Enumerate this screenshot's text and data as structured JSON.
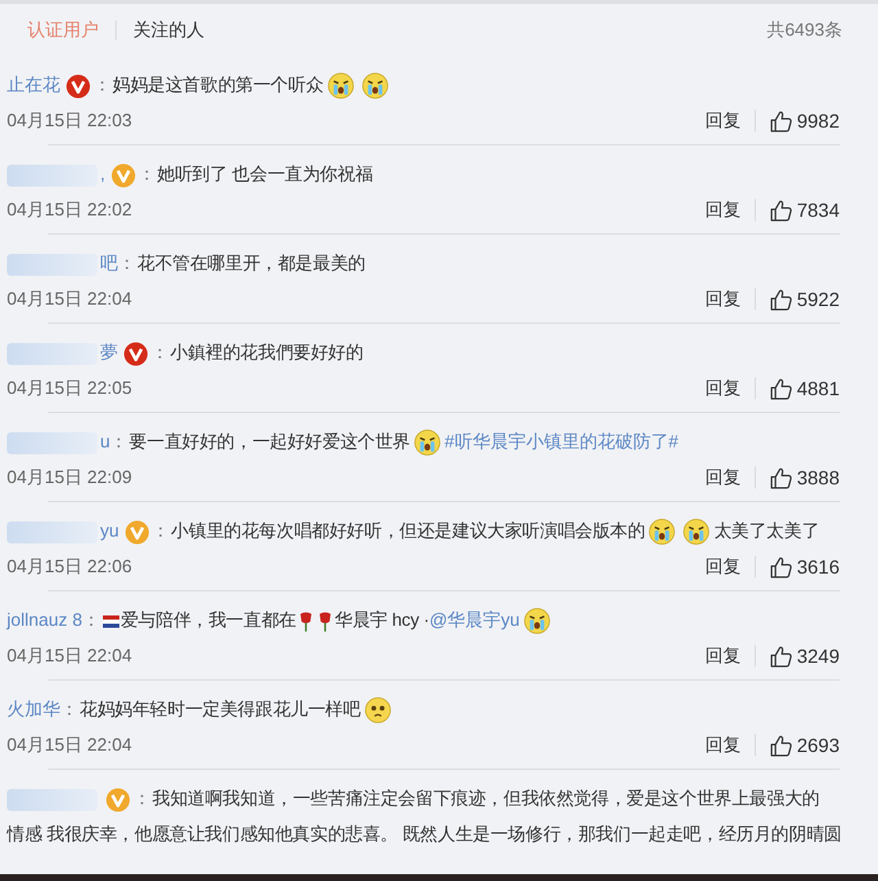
{
  "tabs": [
    {
      "label": "认证用户",
      "selected": true
    },
    {
      "label": "关注的人",
      "selected": false
    }
  ],
  "total": "共6493条",
  "comments": [
    {
      "user": "止在花",
      "badge": {
        "color": "#d52c1a"
      },
      "colon": "：",
      "parts": [
        {
          "kind": "text",
          "text": "妈妈是这首歌的第一个听众"
        },
        {
          "kind": "cry"
        },
        {
          "kind": "cry"
        }
      ],
      "time": "04月15日 22:03",
      "reply": "回复",
      "likes": "9982"
    },
    {
      "user": ",",
      "blurred": true,
      "badge": {
        "color": "#f0a92c"
      },
      "colon": "：",
      "parts": [
        {
          "kind": "text",
          "text": "她听到了 也会一直为你祝福"
        }
      ],
      "time": "04月15日 22:02",
      "reply": "回复",
      "likes": "7834"
    },
    {
      "user": "吧",
      "blurred": true,
      "colon": "：",
      "parts": [
        {
          "kind": "text",
          "text": "花不管在哪里开，都是最美的"
        }
      ],
      "time": "04月15日 22:04",
      "reply": "回复",
      "likes": "5922"
    },
    {
      "user": "夢",
      "blurred": true,
      "badge": {
        "color": "#d52c1a"
      },
      "colon": "：",
      "parts": [
        {
          "kind": "text",
          "text": "小鎮裡的花我們要好好的"
        }
      ],
      "time": "04月15日 22:05",
      "reply": "回复",
      "likes": "4881"
    },
    {
      "user": "u",
      "blurred": true,
      "colon": "：",
      "parts": [
        {
          "kind": "text",
          "text": "要一直好好的，一起好好爱这个世界"
        },
        {
          "kind": "cry"
        },
        {
          "kind": "topic",
          "text": "#听华晨宇小镇里的花破防了#"
        }
      ],
      "time": "04月15日 22:09",
      "reply": "回复",
      "likes": "3888"
    },
    {
      "user": "yu",
      "blurred": true,
      "badge": {
        "color": "#f0a92c"
      },
      "colon": "：",
      "parts": [
        {
          "kind": "text",
          "text": "小镇里的花每次唱都好好听，但还是建议大家听演唱会版本的"
        },
        {
          "kind": "cry"
        },
        {
          "kind": "cry"
        },
        {
          "kind": "text",
          "text": "太美了太美了"
        }
      ],
      "time": "04月15日 22:06",
      "reply": "回复",
      "likes": "3616"
    },
    {
      "user": "jollnauz 8",
      "colon": "：",
      "parts": [
        {
          "kind": "flag"
        },
        {
          "kind": "text",
          "text": "爱与陪伴，我一直都在"
        },
        {
          "kind": "rose"
        },
        {
          "kind": "rose"
        },
        {
          "kind": "text",
          "text": "华晨宇 hcy ·"
        },
        {
          "kind": "mention",
          "text": "@华晨宇yu"
        },
        {
          "kind": "cry"
        }
      ],
      "time": "04月15日 22:04",
      "reply": "回复",
      "likes": "3249"
    },
    {
      "user": "火加华",
      "colon": "：",
      "parts": [
        {
          "kind": "text",
          "text": "花妈妈年轻时一定美得跟花儿一样吧"
        },
        {
          "kind": "worried"
        }
      ],
      "time": "04月15日 22:04",
      "reply": "回复",
      "likes": "2693"
    },
    {
      "blurred": true,
      "badge": {
        "color": "#f0a92c"
      },
      "colon": "：",
      "parts": [
        {
          "kind": "text",
          "text": "我知道啊我知道，一些苦痛注定会留下痕迹，但我依然觉得，爱是这个世界上最强大的"
        },
        {
          "kind": "line",
          "text": "情感 我很庆幸，他愿意让我们感知他真实的悲喜。 既然人生是一场修行，那我们一起走吧，经历月的阴晴圆"
        }
      ]
    }
  ]
}
